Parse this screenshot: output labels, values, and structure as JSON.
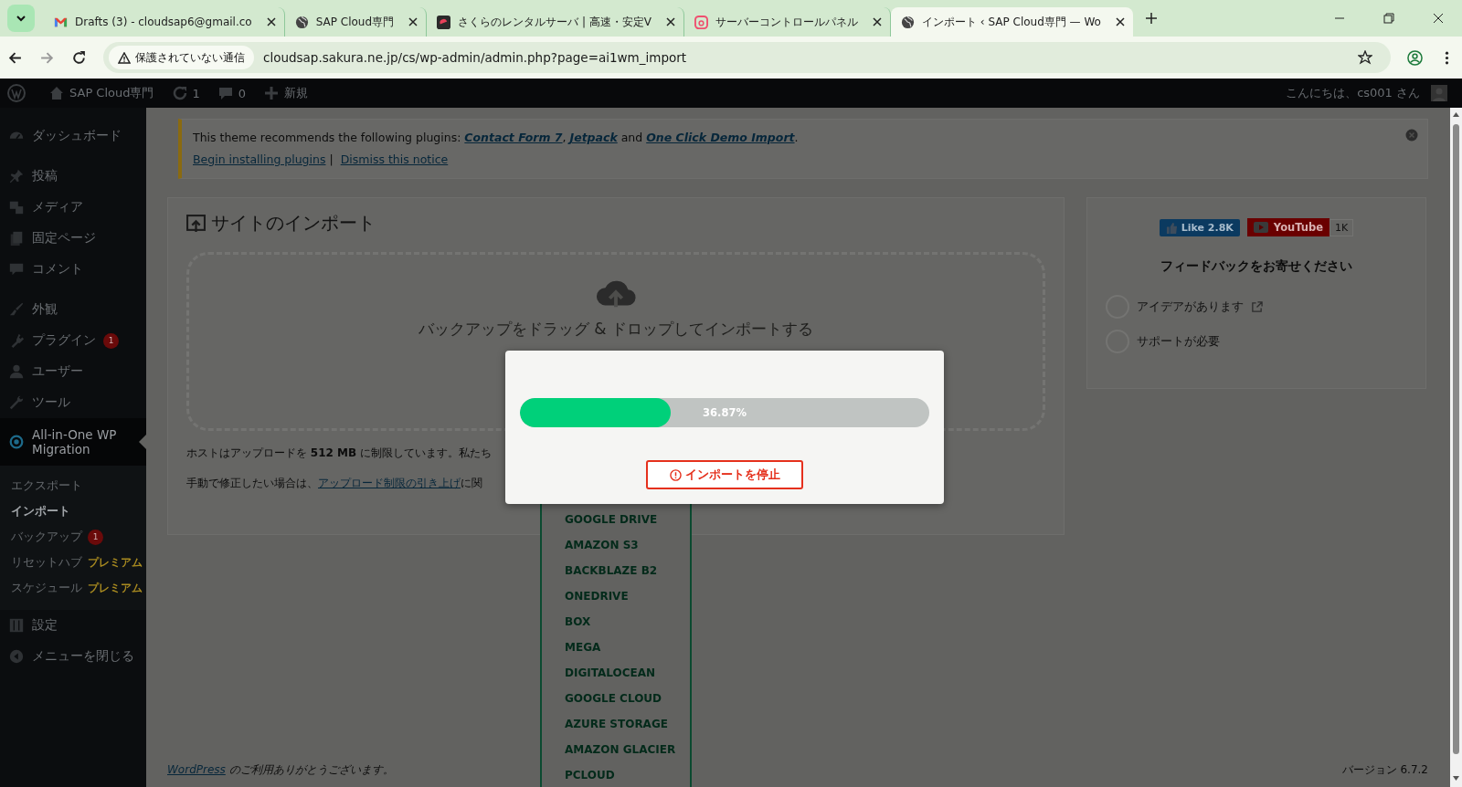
{
  "browser": {
    "tabs": [
      {
        "title": "Drafts (3) - cloudsap6@gmail.co",
        "kind": "mail",
        "selected": false
      },
      {
        "title": "SAP Cloud専門",
        "kind": "globe",
        "selected": false
      },
      {
        "title": "さくらのレンタルサーバ | 高速・安定V",
        "kind": "app",
        "selected": false
      },
      {
        "title": "サーバーコントロールパネル",
        "kind": "panel",
        "selected": false
      },
      {
        "title": "インポート ‹ SAP Cloud専門 — Wo",
        "kind": "globe",
        "selected": true
      }
    ],
    "security_label": "保護されていない通信",
    "url": "cloudsap.sakura.ne.jp/cs/wp-admin/admin.php?page=ai1wm_import"
  },
  "admin_bar": {
    "site_name": "SAP Cloud専門",
    "updates": "1",
    "comments": "0",
    "new": "新規",
    "greeting": "こんにちは、cs001 さん"
  },
  "sidebar": {
    "groups": [
      {
        "items": [
          {
            "label": "ダッシュボード",
            "kind": "dashboard",
            "current": false
          }
        ]
      },
      {
        "items": [
          {
            "label": "投稿",
            "kind": "posts",
            "current": false
          },
          {
            "label": "メディア",
            "kind": "media",
            "current": false
          },
          {
            "label": "固定ページ",
            "kind": "pages",
            "current": false
          },
          {
            "label": "コメント",
            "kind": "comments",
            "current": false
          }
        ]
      },
      {
        "items": [
          {
            "label": "外観",
            "kind": "appearance",
            "current": false
          },
          {
            "label": "プラグイン",
            "kind": "plugins",
            "badge": "1",
            "current": false
          },
          {
            "label": "ユーザー",
            "kind": "users",
            "current": false
          },
          {
            "label": "ツール",
            "kind": "tools",
            "current": false
          },
          {
            "label": "All-in-One WP Migration",
            "kind": "migration",
            "current": true,
            "children": [
              {
                "label": "エクスポート",
                "selected": false
              },
              {
                "label": "インポート",
                "selected": true
              },
              {
                "label": "バックアップ",
                "badge": "1",
                "selected": false
              },
              {
                "label": "リセットハブ",
                "tag": "プレミアム",
                "selected": false
              },
              {
                "label": "スケジュール",
                "tag": "プレミアム",
                "selected": false
              }
            ]
          },
          {
            "label": "設定",
            "kind": "settings",
            "current": false
          },
          {
            "label": "メニューを閉じる",
            "kind": "collapse",
            "current": false
          }
        ]
      }
    ]
  },
  "notice": {
    "message": [
      {
        "text": "This theme recommends the following plugins: ",
        "link": false
      },
      {
        "text": "Contact Form 7",
        "link": true
      },
      {
        "text": ", ",
        "link": false
      },
      {
        "text": "Jetpack",
        "link": true
      },
      {
        "text": " and ",
        "link": false
      },
      {
        "text": "One Click Demo Import",
        "link": true
      },
      {
        "text": ".",
        "link": false
      }
    ],
    "actions": [
      "Begin installing plugins",
      "Dismiss this notice"
    ],
    "separator": "|"
  },
  "import_panel": {
    "title": "サイトのインポート",
    "drop_text": "バックアップをドラッグ & ドロップしてインポートする",
    "limit_text": "ホストはアップロードを **512 MB** に制限しています。私たち",
    "fix_text": [
      {
        "text": "手動で修正したい場合は、",
        "link": false
      },
      {
        "text": "アップロード制限の引き上げ",
        "link": true
      },
      {
        "text": "に関",
        "link": false
      }
    ]
  },
  "import_menu": {
    "items": [
      "GOOGLE DRIVE",
      "AMAZON S3",
      "BACKBLAZE B2",
      "ONEDRIVE",
      "BOX",
      "MEGA",
      "DIGITALOCEAN",
      "GOOGLE CLOUD",
      "AZURE STORAGE",
      "AMAZON GLACIER",
      "PCLOUD"
    ]
  },
  "progress_dialog": {
    "level": 0.3687,
    "reading": "36.87%",
    "stop_button": "インポートを停止"
  },
  "feedback": {
    "like": "Like 2.8K",
    "youtube": "YouTube",
    "youtube_count": "1K",
    "heading": "フィードバックをお寄せください",
    "options": [
      {
        "label": "アイデアがあります",
        "external": true,
        "selected": false
      },
      {
        "label": "サポートが必要",
        "external": false,
        "selected": false
      }
    ]
  },
  "footer": {
    "thanks": [
      {
        "text": "WordPress",
        "link": true
      },
      {
        "text": " のご利用ありがとうございます。",
        "link": false
      }
    ],
    "version": "バージョン 6.7.2"
  }
}
